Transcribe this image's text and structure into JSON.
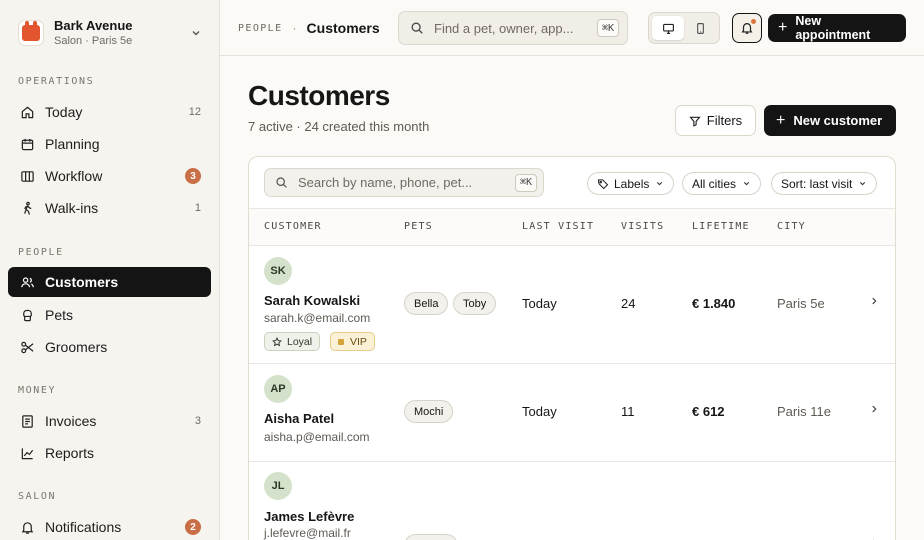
{
  "brand": {
    "name": "Bark Avenue",
    "subtitle": "Salon · Paris 5e"
  },
  "sidebar": {
    "sections": [
      {
        "title": "OPERATIONS",
        "items": [
          {
            "label": "Today",
            "count": "12",
            "icon": "home-icon"
          },
          {
            "label": "Planning",
            "count": "",
            "icon": "calendar-icon"
          },
          {
            "label": "Workflow",
            "badge": "3",
            "icon": "columns-icon"
          },
          {
            "label": "Walk-ins",
            "count": "1",
            "icon": "walking-icon"
          }
        ]
      },
      {
        "title": "PEOPLE",
        "items": [
          {
            "label": "Customers",
            "active": true,
            "icon": "users-icon"
          },
          {
            "label": "Pets",
            "icon": "paw-icon"
          },
          {
            "label": "Groomers",
            "icon": "scissors-icon"
          }
        ]
      },
      {
        "title": "MONEY",
        "items": [
          {
            "label": "Invoices",
            "count": "3",
            "icon": "receipt-icon"
          },
          {
            "label": "Reports",
            "icon": "chart-icon"
          }
        ]
      },
      {
        "title": "SALON",
        "items": [
          {
            "label": "Notifications",
            "badge": "2",
            "icon": "bell-icon"
          }
        ]
      }
    ]
  },
  "topbar": {
    "crumb_section": "PEOPLE",
    "crumb_sep": "·",
    "crumb_page": "Customers",
    "search_placeholder": "Find a pet, owner, app...",
    "search_shortcut": "⌘K",
    "new_appointment": "New appointment"
  },
  "page": {
    "title": "Customers",
    "subtitle": "7 active · 24 created this month",
    "filters_label": "Filters",
    "new_customer": "New customer"
  },
  "table": {
    "search_placeholder": "Search by name, phone, pet...",
    "search_shortcut": "⌘K",
    "filter_labels": "Labels",
    "filter_cities": "All cities",
    "sort": "Sort: last visit",
    "columns": [
      "CUSTOMER",
      "PETS",
      "LAST VISIT",
      "VISITS",
      "LIFETIME",
      "CITY"
    ],
    "rows": [
      {
        "initials": "SK",
        "name": "Sarah Kowalski",
        "email": "sarah.k@email.com",
        "pets": [
          "Bella",
          "Toby"
        ],
        "last_visit": "Today",
        "visits": "24",
        "lifetime": "€ 1.840",
        "city": "Paris 5e",
        "tags": [
          "Loyal",
          "VIP"
        ]
      },
      {
        "initials": "AP",
        "name": "Aisha Patel",
        "email": "aisha.p@email.com",
        "pets": [
          "Mochi"
        ],
        "last_visit": "Today",
        "visits": "11",
        "lifetime": "€ 612",
        "city": "Paris 11e",
        "tags": []
      },
      {
        "initials": "JL",
        "name": "James Lefèvre",
        "email": "j.lefevre@mail.fr",
        "pets": [
          ""
        ],
        "last_visit": "",
        "visits": "",
        "lifetime": "",
        "city": "",
        "tags": []
      }
    ]
  }
}
